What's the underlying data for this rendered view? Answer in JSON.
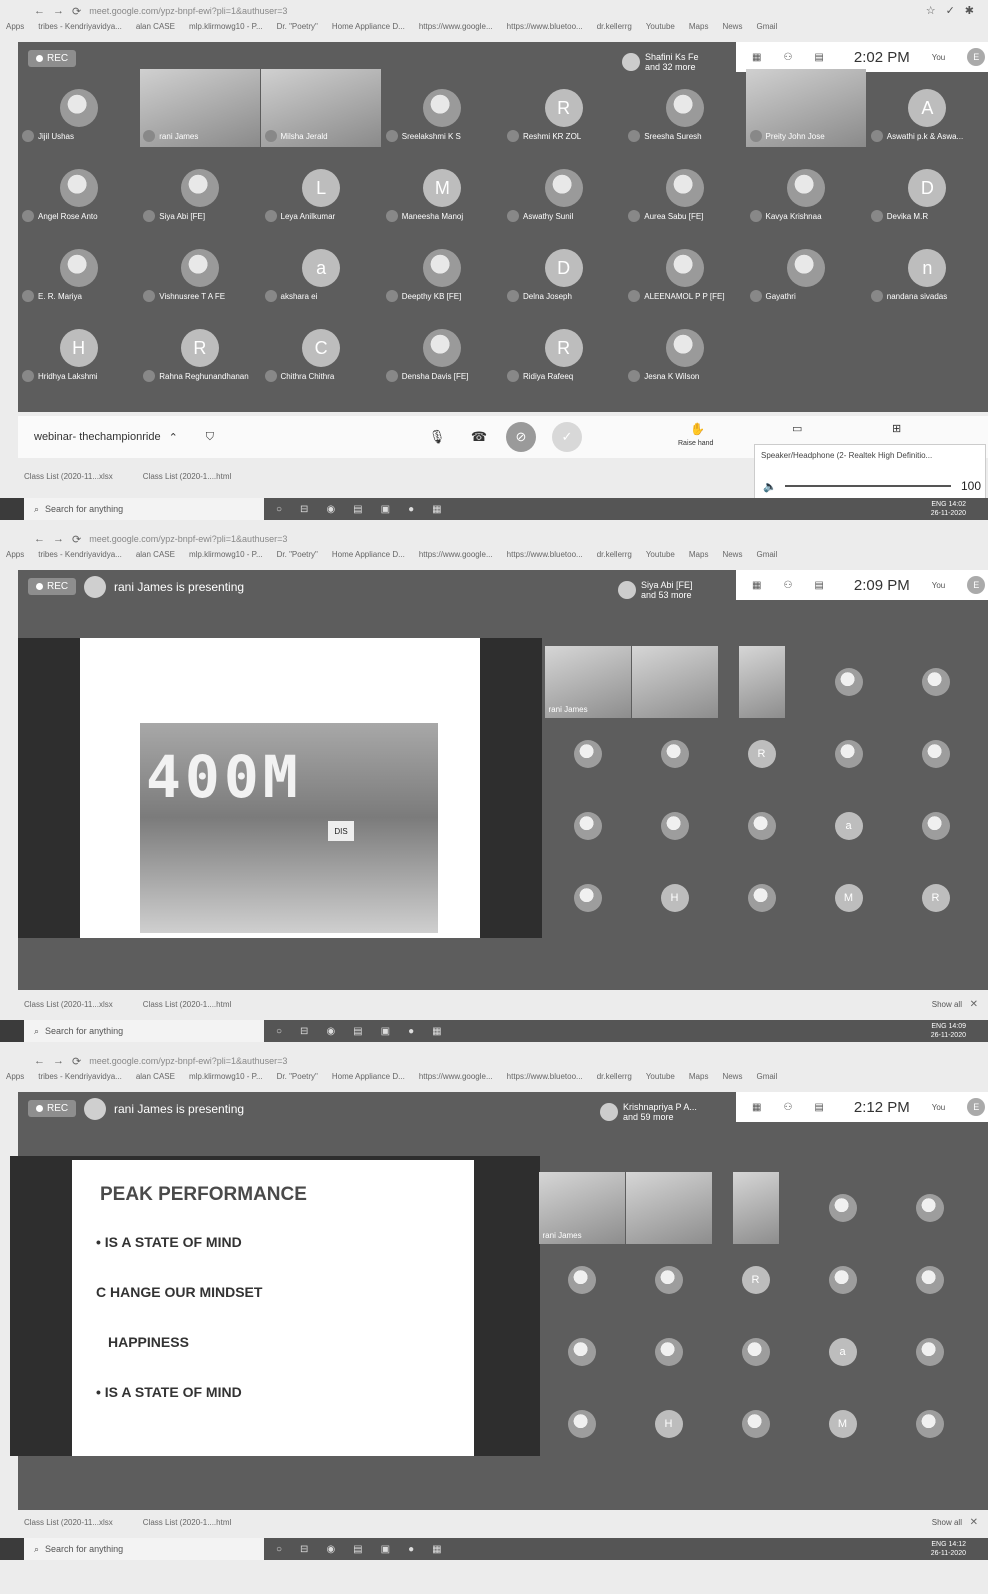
{
  "shot1": {
    "browser": {
      "url": "meet.google.com/ypz-bnpf-ewi?pli=1&authuser=3"
    },
    "bookmarks": [
      "Apps",
      "tribes - Kendriyavidya...",
      "alan CASE",
      "mlp.klirmowg10 - P...",
      "Dr. \"Poetry\"",
      "Home Appliance D...",
      "https://www.google...",
      "https://www.bluetoo...",
      "dr.kellerrg",
      "Youtube",
      "Maps",
      "News",
      "Gmail"
    ],
    "rec": "REC",
    "attendees": {
      "name": "Shafini Ks Fe",
      "more": "and 32 more"
    },
    "clock": "2:02 PM",
    "you": "You",
    "user_initial": "E",
    "participants": [
      {
        "name": "Jijil Ushas",
        "letter": "",
        "type": "photo"
      },
      {
        "name": "rani James",
        "letter": "",
        "type": "video"
      },
      {
        "name": "Milsha Jerald",
        "letter": "",
        "type": "video"
      },
      {
        "name": "Sreelakshmi K S",
        "letter": "",
        "type": "photo"
      },
      {
        "name": "Reshmi KR ZOL",
        "letter": "R",
        "type": "letter"
      },
      {
        "name": "Sreesha Suresh",
        "letter": "",
        "type": "photo"
      },
      {
        "name": "Preity John Jose",
        "letter": "",
        "type": "video"
      },
      {
        "name": "Aswathi p.k & Aswa...",
        "letter": "A",
        "type": "letter"
      },
      {
        "name": "Angel Rose Anto",
        "letter": "",
        "type": "photo"
      },
      {
        "name": "Siya Abi [FE]",
        "letter": "",
        "type": "photo"
      },
      {
        "name": "Leya Anilkumar",
        "letter": "L",
        "type": "letter"
      },
      {
        "name": "Maneesha Manoj",
        "letter": "M",
        "type": "letter"
      },
      {
        "name": "Aswathy Sunil",
        "letter": "",
        "type": "photo"
      },
      {
        "name": "Aurea Sabu [FE]",
        "letter": "",
        "type": "photo"
      },
      {
        "name": "Kavya Krishnaa",
        "letter": "",
        "type": "photo"
      },
      {
        "name": "Devika M.R",
        "letter": "D",
        "type": "letter"
      },
      {
        "name": "E. R. Mariya",
        "letter": "",
        "type": "photo"
      },
      {
        "name": "Vishnusree T A FE",
        "letter": "",
        "type": "photo"
      },
      {
        "name": "akshara ei",
        "letter": "a",
        "type": "letter"
      },
      {
        "name": "Deepthy KB [FE]",
        "letter": "",
        "type": "photo"
      },
      {
        "name": "Delna Joseph",
        "letter": "D",
        "type": "letter"
      },
      {
        "name": "ALEENAMOL P P [FE]",
        "letter": "",
        "type": "photo"
      },
      {
        "name": "Gayathri",
        "letter": "",
        "type": "photo"
      },
      {
        "name": "nandana sivadas",
        "letter": "n",
        "type": "letter"
      },
      {
        "name": "Hridhya Lakshmi",
        "letter": "H",
        "type": "letter"
      },
      {
        "name": "Rahna Reghunandhanan",
        "letter": "R",
        "type": "letter"
      },
      {
        "name": "Chithra Chithra",
        "letter": "C",
        "type": "letter"
      },
      {
        "name": "Densha Davis [FE]",
        "letter": "",
        "type": "photo"
      },
      {
        "name": "Ridiya Rafeeq",
        "letter": "R",
        "type": "letter"
      },
      {
        "name": "Jesna K Wilson",
        "letter": "",
        "type": "photo"
      }
    ],
    "meeting_name": "webinar- thechampionride",
    "raise_hand": "Raise hand",
    "popup": {
      "title": "Speaker/Headphone (2- Realtek High Definitio...",
      "volume": "100"
    },
    "downloads": [
      "Class List (2020-11...xlsx",
      "Class List (2020-1....html"
    ],
    "taskbar": {
      "search": "Search for anything",
      "lang": "ENG",
      "time": "14:02",
      "date": "26-11-2020"
    }
  },
  "shot2": {
    "bookmarks": [
      "Apps",
      "tribes - Kendriyavidya...",
      "alan CASE",
      "mlp.klirmowg10 - P...",
      "Dr. \"Poetry\"",
      "Home Appliance D...",
      "https://www.google...",
      "https://www.bluetoo...",
      "dr.kellerrg",
      "Youtube",
      "Maps",
      "News",
      "Gmail"
    ],
    "rec": "REC",
    "presenting": "rani James is presenting",
    "attendees": {
      "name": "Siya Abi [FE]",
      "more": "and 53 more"
    },
    "clock": "2:09 PM",
    "you": "You",
    "user_initial": "E",
    "slide_text": "400M",
    "bib": "DIS",
    "presenter_label": "rani James",
    "tiles": [
      "",
      "",
      "",
      "",
      "",
      "",
      "R",
      "",
      "",
      "",
      "",
      "",
      "a",
      "",
      "",
      "H",
      "",
      "M",
      "R"
    ],
    "downloads": [
      "Class List (2020-11...xlsx",
      "Class List (2020-1....html"
    ],
    "show_all": "Show all",
    "taskbar": {
      "search": "Search for anything",
      "lang": "ENG",
      "time": "14:09",
      "date": "26-11-2020"
    }
  },
  "shot3": {
    "bookmarks": [
      "Apps",
      "tribes - Kendriyavidya...",
      "alan CASE",
      "mlp.klirmowg10 - P...",
      "Dr. \"Poetry\"",
      "Home Appliance D...",
      "https://www.google...",
      "https://www.bluetoo...",
      "dr.kellerrg",
      "Youtube",
      "Maps",
      "News",
      "Gmail"
    ],
    "rec": "REC",
    "presenting": "rani James is presenting",
    "attendees": {
      "name": "Krishnapriya P A...",
      "more": "and 59 more"
    },
    "clock": "2:12 PM",
    "you": "You",
    "user_initial": "E",
    "slide": {
      "title": "PEAK PERFORMANCE",
      "line1": "• IS A STATE OF MIND",
      "line2": "C HANGE OUR MINDSET",
      "line3": "HAPPINESS",
      "line4": "• IS A STATE OF MIND"
    },
    "presenter_label": "rani James",
    "tiles": [
      "",
      "",
      "",
      "",
      "",
      "",
      "R",
      "",
      "",
      "",
      "",
      "",
      "a",
      "",
      "",
      "H",
      "",
      "M",
      ""
    ],
    "downloads": [
      "Class List (2020-11...xlsx",
      "Class List (2020-1....html"
    ],
    "show_all": "Show all",
    "taskbar": {
      "search": "Search for anything",
      "lang": "ENG",
      "time": "14:12",
      "date": "26-11-2020"
    }
  },
  "colors": {
    "meet_bg": "#5d5d5d",
    "stage_bg": "#2e2e2e",
    "chrome": "#ececec"
  }
}
